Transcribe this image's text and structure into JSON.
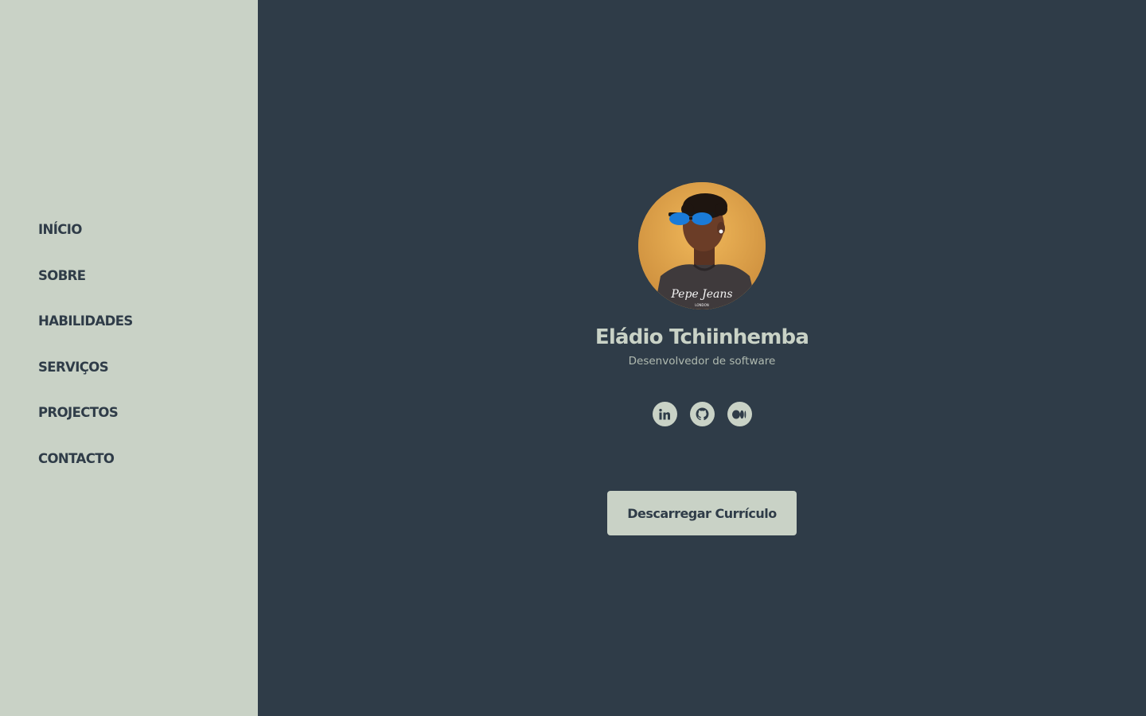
{
  "nav": {
    "items": [
      {
        "label": "INÍCIO"
      },
      {
        "label": "SOBRE"
      },
      {
        "label": "HABILIDADES"
      },
      {
        "label": "SERVIÇOS"
      },
      {
        "label": "PROJECTOS"
      },
      {
        "label": "CONTACTO"
      }
    ]
  },
  "profile": {
    "name": "Eládio Tchiinhemba",
    "title": "Desenvolvedor de software",
    "shirt_logo": "Pepe Jeans",
    "shirt_sublabel": "LONDON"
  },
  "socials": [
    {
      "icon": "linkedin-icon"
    },
    {
      "icon": "github-icon"
    },
    {
      "icon": "medium-icon"
    }
  ],
  "cta": {
    "download_cv_label": "Descarregar Currículo"
  },
  "colors": {
    "sidebar_bg": "#c9d2c6",
    "main_bg": "#2f3c48",
    "accent": "#c9d2c6",
    "text_dark": "#2f3c48"
  }
}
